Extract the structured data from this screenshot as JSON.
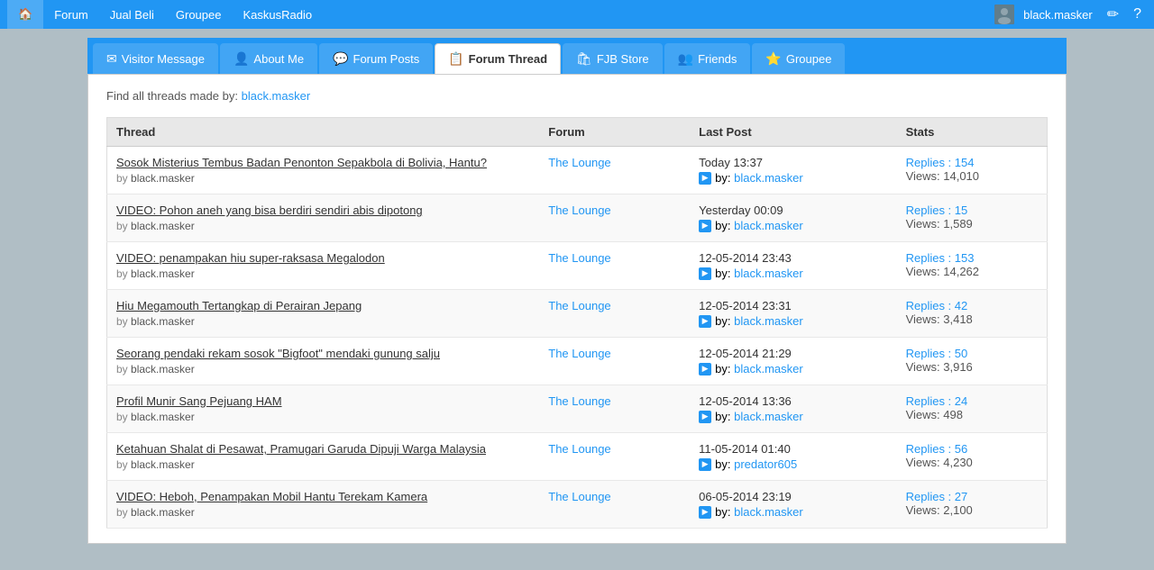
{
  "topnav": {
    "items": [
      {
        "label": "Forum",
        "icon": "home"
      },
      {
        "label": "Forum"
      },
      {
        "label": "Jual Beli"
      },
      {
        "label": "Groupee"
      },
      {
        "label": "KaskusRadio"
      }
    ],
    "username": "black.masker"
  },
  "tabs": [
    {
      "id": "visitor-message",
      "label": "Visitor Message",
      "icon": "✉"
    },
    {
      "id": "about-me",
      "label": "About Me",
      "icon": "👤"
    },
    {
      "id": "forum-posts",
      "label": "Forum Posts",
      "icon": "💬"
    },
    {
      "id": "forum-thread",
      "label": "Forum Thread",
      "icon": "📋",
      "active": true
    },
    {
      "id": "fjb-store",
      "label": "FJB Store",
      "icon": "🛍"
    },
    {
      "id": "friends",
      "label": "Friends",
      "icon": "👥"
    },
    {
      "id": "groupee",
      "label": "Groupee",
      "icon": "⭐"
    }
  ],
  "findAll": {
    "prefix": "Find all threads made by:",
    "username": "black.masker"
  },
  "table": {
    "headers": {
      "thread": "Thread",
      "forum": "Forum",
      "lastPost": "Last Post",
      "stats": "Stats"
    },
    "rows": [
      {
        "title": "Sosok Misterius Tembus Badan Penonton Sepakbola di Bolivia, Hantu?",
        "by": "black.masker",
        "forum": "The Lounge",
        "lastPostTime": "Today 13:37",
        "lastPostBy": "black.masker",
        "repliesLabel": "Replies : 154",
        "repliesCount": "154",
        "views": "Views: 14,010"
      },
      {
        "title": "VIDEO: Pohon aneh yang bisa berdiri sendiri abis dipotong",
        "by": "black.masker",
        "forum": "The Lounge",
        "lastPostTime": "Yesterday 00:09",
        "lastPostBy": "black.masker",
        "repliesLabel": "Replies : 15",
        "repliesCount": "15",
        "views": "Views: 1,589"
      },
      {
        "title": "VIDEO: penampakan hiu super-raksasa Megalodon",
        "by": "black.masker",
        "forum": "The Lounge",
        "lastPostTime": "12-05-2014 23:43",
        "lastPostBy": "black.masker",
        "repliesLabel": "Replies : 153",
        "repliesCount": "153",
        "views": "Views: 14,262"
      },
      {
        "title": "Hiu Megamouth Tertangkap di Perairan Jepang",
        "by": "black.masker",
        "forum": "The Lounge",
        "lastPostTime": "12-05-2014 23:31",
        "lastPostBy": "black.masker",
        "repliesLabel": "Replies : 42",
        "repliesCount": "42",
        "views": "Views: 3,418"
      },
      {
        "title": "Seorang pendaki rekam sosok \"Bigfoot\" mendaki gunung salju",
        "by": "black.masker",
        "forum": "The Lounge",
        "lastPostTime": "12-05-2014 21:29",
        "lastPostBy": "black.masker",
        "repliesLabel": "Replies : 50",
        "repliesCount": "50",
        "views": "Views: 3,916"
      },
      {
        "title": "Profil Munir Sang Pejuang HAM",
        "by": "black.masker",
        "forum": "The Lounge",
        "lastPostTime": "12-05-2014 13:36",
        "lastPostBy": "black.masker",
        "repliesLabel": "Replies : 24",
        "repliesCount": "24",
        "views": "Views: 498"
      },
      {
        "title": "Ketahuan Shalat di Pesawat, Pramugari Garuda Dipuji Warga Malaysia",
        "by": "black.masker",
        "forum": "The Lounge",
        "lastPostTime": "11-05-2014 01:40",
        "lastPostBy": "predator605",
        "repliesLabel": "Replies : 56",
        "repliesCount": "56",
        "views": "Views: 4,230"
      },
      {
        "title": "VIDEO: Heboh, Penampakan Mobil Hantu Terekam Kamera",
        "by": "black.masker",
        "forum": "The Lounge",
        "lastPostTime": "06-05-2014 23:19",
        "lastPostBy": "black.masker",
        "repliesLabel": "Replies : 27",
        "repliesCount": "27",
        "views": "Views: 2,100"
      }
    ]
  }
}
